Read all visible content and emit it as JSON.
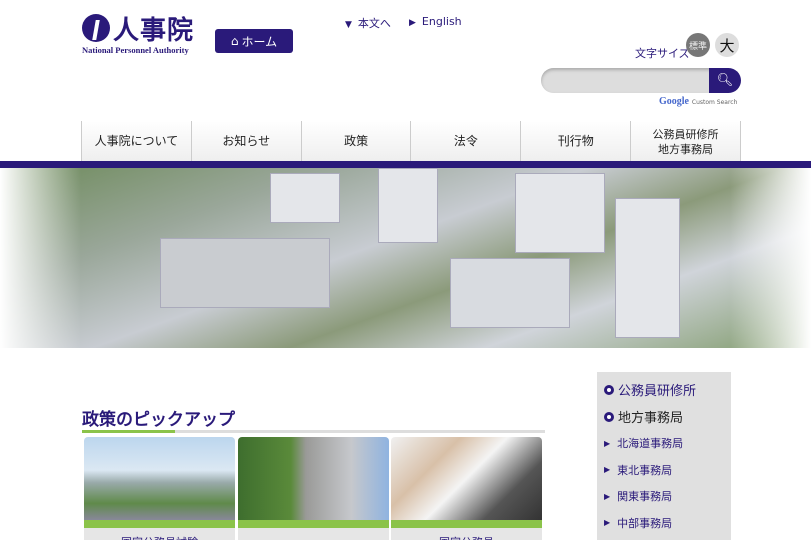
{
  "header": {
    "logo_text": "人事院",
    "logo_subtitle": "National Personnel Authority",
    "home_label": "ホーム",
    "skip_link": "本文へ",
    "english_link": "English",
    "font_size_label": "文字サイズ",
    "font_std": "標準",
    "font_large": "大",
    "search_placeholder": "",
    "google_label": "Google",
    "custom_search": "Custom Search"
  },
  "nav": [
    "人事院について",
    "お知らせ",
    "政策",
    "法令",
    "刊行物",
    "公務員研修所\n地方事務局"
  ],
  "section": {
    "title": "政策のピックアップ",
    "cards": [
      {
        "label": "国家公務員試験"
      },
      {
        "label": ""
      },
      {
        "label": "国家公務員"
      }
    ]
  },
  "sidebar": {
    "headings": [
      "公務員研修所",
      "地方事務局"
    ],
    "items": [
      "北海道事務局",
      "東北事務局",
      "関東事務局",
      "中部事務局"
    ]
  },
  "colors": {
    "brand": "#2a1a7a",
    "accent": "#8bc34a"
  }
}
